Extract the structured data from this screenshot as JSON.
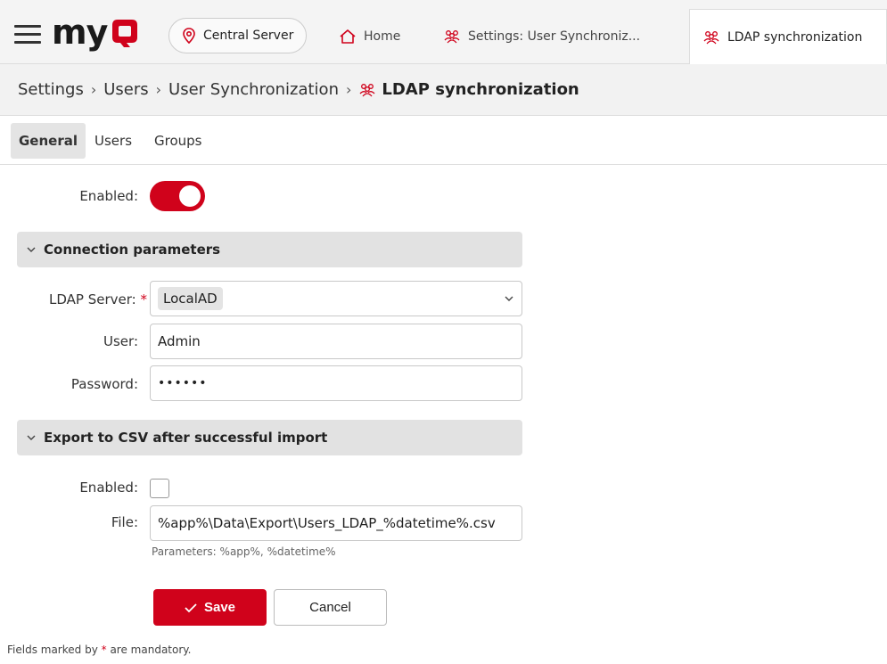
{
  "header": {
    "logo_text": "my",
    "server_label": "Central Server",
    "tabs": [
      {
        "label": "Home",
        "icon": "home-icon"
      },
      {
        "label": "Settings: User Synchroniz...",
        "icon": "users-icon"
      },
      {
        "label": "LDAP synchronization",
        "icon": "users-icon",
        "active": true
      }
    ]
  },
  "breadcrumb": {
    "items": [
      "Settings",
      "Users",
      "User Synchronization"
    ],
    "current": "LDAP synchronization",
    "separator": "›"
  },
  "subtabs": {
    "general": "General",
    "users": "Users",
    "groups": "Groups"
  },
  "form": {
    "enabled_label": "Enabled:",
    "enabled_value": true,
    "connection_section": "Connection parameters",
    "ldap_server_label": "LDAP Server:",
    "ldap_server_value": "LocalAD",
    "user_label": "User:",
    "user_value": "Admin",
    "password_label": "Password:",
    "password_value": "••••••",
    "export_section": "Export to CSV after successful import",
    "export_enabled_label": "Enabled:",
    "export_enabled_value": false,
    "file_label": "File:",
    "file_value": "%app%\\Data\\Export\\Users_LDAP_%datetime%.csv",
    "file_hint": "Parameters: %app%, %datetime%"
  },
  "buttons": {
    "save": "Save",
    "cancel": "Cancel"
  },
  "footer": {
    "note_prefix": "Fields marked by",
    "asterisk": "*",
    "note_suffix": "are mandatory."
  },
  "colors": {
    "accent": "#d0021b"
  }
}
